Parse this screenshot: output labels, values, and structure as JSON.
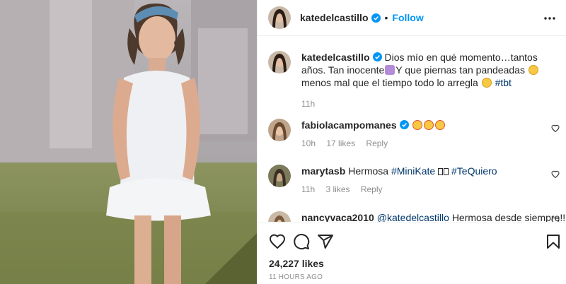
{
  "post": {
    "author": "katedelcastillo",
    "follow_label": "Follow",
    "separator": "•"
  },
  "caption": {
    "author": "katedelcastillo",
    "text_1": "Dios mío en qué momento…tantos años. Tan inocente",
    "text_2": "Y que piernas tan pandeadas",
    "text_3": "menos mal que el tiempo todo lo arregla",
    "hashtag": "#tbt",
    "time": "11h"
  },
  "comments": [
    {
      "author": "fabiolacampomanes",
      "text": "",
      "time": "10h",
      "likes": "17 likes",
      "reply": "Reply"
    },
    {
      "author": "marytasb",
      "text": "Hermosa",
      "tag1": "#MiniKate",
      "text2": "",
      "tag2": "#TeQuiero",
      "time": "11h",
      "likes": "3 likes",
      "reply": "Reply"
    },
    {
      "author": "nancyvaca2010",
      "mention": "@katedelcastillo",
      "text": "Hermosa desde siempre!!! Te"
    }
  ],
  "footer": {
    "likes": "24,227 likes",
    "time": "11 HOURS AGO"
  },
  "icons": {
    "verified": "verified-badge-icon",
    "more": "more-options-icon",
    "like": "heart-icon",
    "comment": "comment-icon",
    "share": "paper-plane-icon",
    "save": "bookmark-icon"
  },
  "colors": {
    "accent": "#0095f6",
    "link": "#00376b",
    "muted": "#8e8e8e",
    "text": "#262626"
  }
}
